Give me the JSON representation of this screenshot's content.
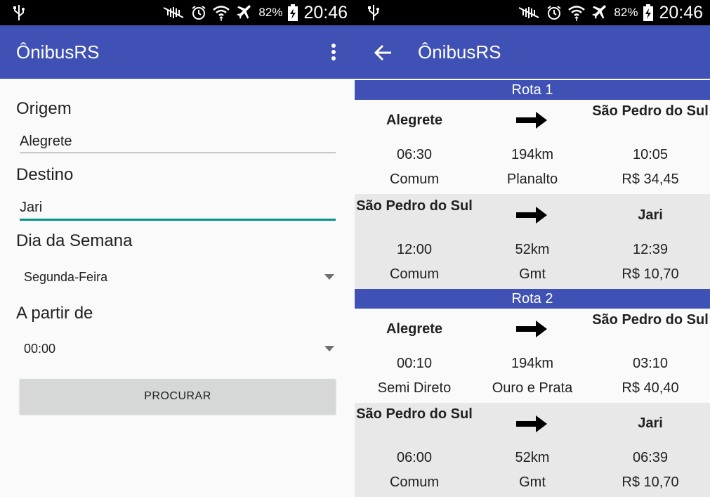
{
  "status": {
    "battery": "82%",
    "time": "20:46"
  },
  "left": {
    "app_title": "ÔnibusRS",
    "origin_label": "Origem",
    "origin_value": "Alegrete",
    "destination_label": "Destino",
    "destination_value": "Jari",
    "weekday_label": "Dia da Semana",
    "weekday_value": "Segunda-Feira",
    "from_label": "A partir de",
    "from_value": "00:00",
    "search_button": "PROCURAR"
  },
  "right": {
    "app_title": "ÔnibusRS",
    "routes": [
      {
        "title": "Rota 1",
        "legs": [
          {
            "from": "Alegrete",
            "to": "São Pedro do Sul",
            "depart": "06:30",
            "distance": "194km",
            "arrive": "10:05",
            "type": "Comum",
            "company": "Planalto",
            "price": "R$ 34,45"
          },
          {
            "from": "São Pedro do Sul",
            "to": "Jari",
            "depart": "12:00",
            "distance": "52km",
            "arrive": "12:39",
            "type": "Comum",
            "company": "Gmt",
            "price": "R$ 10,70"
          }
        ]
      },
      {
        "title": "Rota 2",
        "legs": [
          {
            "from": "Alegrete",
            "to": "São Pedro do Sul",
            "depart": "00:10",
            "distance": "194km",
            "arrive": "03:10",
            "type": "Semi Direto",
            "company": "Ouro e Prata",
            "price": "R$ 40,40"
          },
          {
            "from": "São Pedro do Sul",
            "to": "Jari",
            "depart": "06:00",
            "distance": "52km",
            "arrive": "06:39",
            "type": "Comum",
            "company": "Gmt",
            "price": "R$ 10,70"
          }
        ]
      }
    ]
  },
  "colors": {
    "primary": "#3f51b5",
    "accent": "#009688",
    "alt_row": "#e8e8e8"
  },
  "icons": {
    "usb": "usb-icon",
    "mute": "mute-icon",
    "alarm": "alarm-icon",
    "wifi": "wifi-icon",
    "airplane": "airplane-icon",
    "battery": "battery-charging-icon",
    "menu": "overflow-menu-icon",
    "back": "back-arrow-icon",
    "leg_arrow": "right-arrow-icon"
  }
}
